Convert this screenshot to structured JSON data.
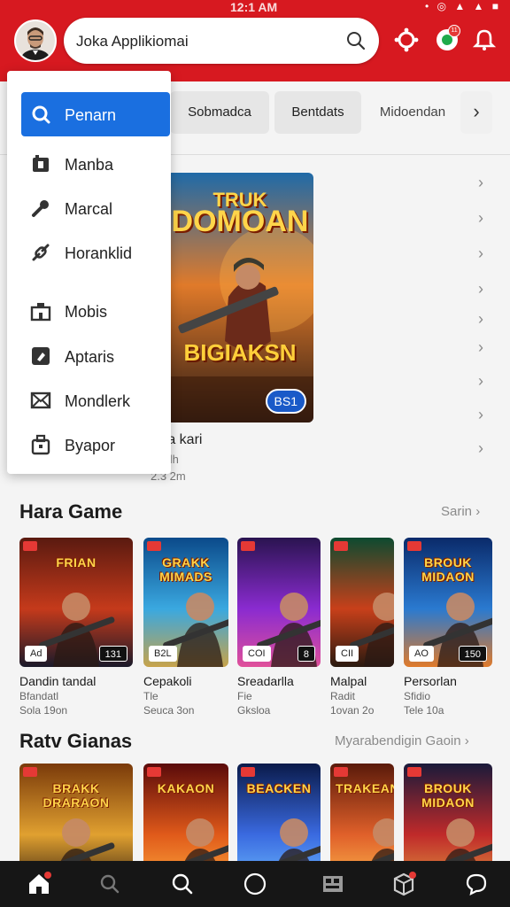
{
  "status_bar": {
    "time": "12:1 AM",
    "icons": "• ◎ ▲ ▲ ■"
  },
  "header": {
    "search_text": "Joka Applikiomai",
    "accent_color": "#d71920",
    "icons": [
      "notification-icon",
      "cart-icon",
      "bell-icon"
    ],
    "badge": "11"
  },
  "chips": [
    {
      "label": "Sobmadca"
    },
    {
      "label": "Bentdats"
    },
    {
      "label": "Midoendan"
    }
  ],
  "menu": {
    "selected": {
      "label": "Penarn",
      "icon": "search-icon"
    },
    "items": [
      {
        "label": "Manba",
        "icon": "box-icon"
      },
      {
        "label": "Marcal",
        "icon": "wrench-icon"
      },
      {
        "label": "Horanklid",
        "icon": "link-icon"
      },
      {
        "label": "Mobis",
        "icon": "building-icon"
      },
      {
        "label": "Aptaris",
        "icon": "app-icon"
      },
      {
        "label": "Mondlerk",
        "icon": "mail-icon"
      },
      {
        "label": "Byapor",
        "icon": "bag-icon"
      }
    ]
  },
  "featured": {
    "title_line1": "TRUK",
    "title_line2": "DOMOAN",
    "subtitle": "BIGIAKSN",
    "badge": "BS1",
    "caption": "ma kari",
    "sub": "gigdh",
    "meta": "2.3 2m"
  },
  "section1": {
    "title": "Hara Game",
    "link": "Sarin",
    "cards": [
      {
        "cover_title": "FRIAN",
        "badge": "Ad",
        "badge2": "131",
        "name": "Dandin tandal",
        "sub": "Bfandatl",
        "meta": "Sola 19on",
        "colors": [
          "#5a1a10",
          "#c53a1b",
          "#1a1a2a"
        ]
      },
      {
        "cover_title": "GRAKK MIMADS",
        "badge": "B2L",
        "badge2": "",
        "name": "Cepakoli",
        "sub": "Tle",
        "meta": "Seuca 3on",
        "colors": [
          "#0b4a8a",
          "#3aa8e0",
          "#c7a34a"
        ]
      },
      {
        "cover_title": "",
        "badge": "COI",
        "badge2": "8",
        "name": "Sreadarlla",
        "sub": "Fie",
        "meta": "Gksloa",
        "colors": [
          "#2a1450",
          "#8a2bd0",
          "#e0509a"
        ]
      },
      {
        "cover_title": "",
        "badge": "CII",
        "badge2": "",
        "name": "Malpal",
        "sub": "Radit",
        "meta": "1ovan 2o",
        "colors": [
          "#0d4a30",
          "#c8401a",
          "#2a1a10"
        ]
      },
      {
        "cover_title": "BROUK MIDAON",
        "badge": "AO",
        "badge2": "150",
        "name": "Persorlan",
        "sub": "Sfidio",
        "meta": "Tele 10a",
        "colors": [
          "#0a2a6a",
          "#2a7ad0",
          "#e07a2a"
        ]
      }
    ]
  },
  "section2": {
    "title": "Ratv Gianas",
    "link": "Myarabendigin Gaoin",
    "cards": [
      {
        "cover_title": "BRAKK DRARAON",
        "colors": [
          "#7a3a0a",
          "#e0a030",
          "#2a1a10"
        ]
      },
      {
        "cover_title": "KAKAON",
        "colors": [
          "#5a0a0a",
          "#e05a1a",
          "#ffb040"
        ]
      },
      {
        "cover_title": "BEACKEN",
        "colors": [
          "#0a1a4a",
          "#3a6ae0",
          "#70c0ff"
        ]
      },
      {
        "cover_title": "TRAKEAN",
        "colors": [
          "#5a1a0a",
          "#e0602a",
          "#ffc050"
        ]
      },
      {
        "cover_title": "BROUK MIDAON",
        "colors": [
          "#1a1a3a",
          "#c02a2a",
          "#e0a040"
        ]
      }
    ]
  },
  "bottom_nav": {
    "items": [
      {
        "icon": "home-icon"
      },
      {
        "icon": "search-icon"
      },
      {
        "icon": "explore-icon"
      },
      {
        "icon": "circle-icon"
      },
      {
        "icon": "library-icon"
      },
      {
        "icon": "package-icon"
      },
      {
        "icon": "profile-icon"
      }
    ]
  }
}
